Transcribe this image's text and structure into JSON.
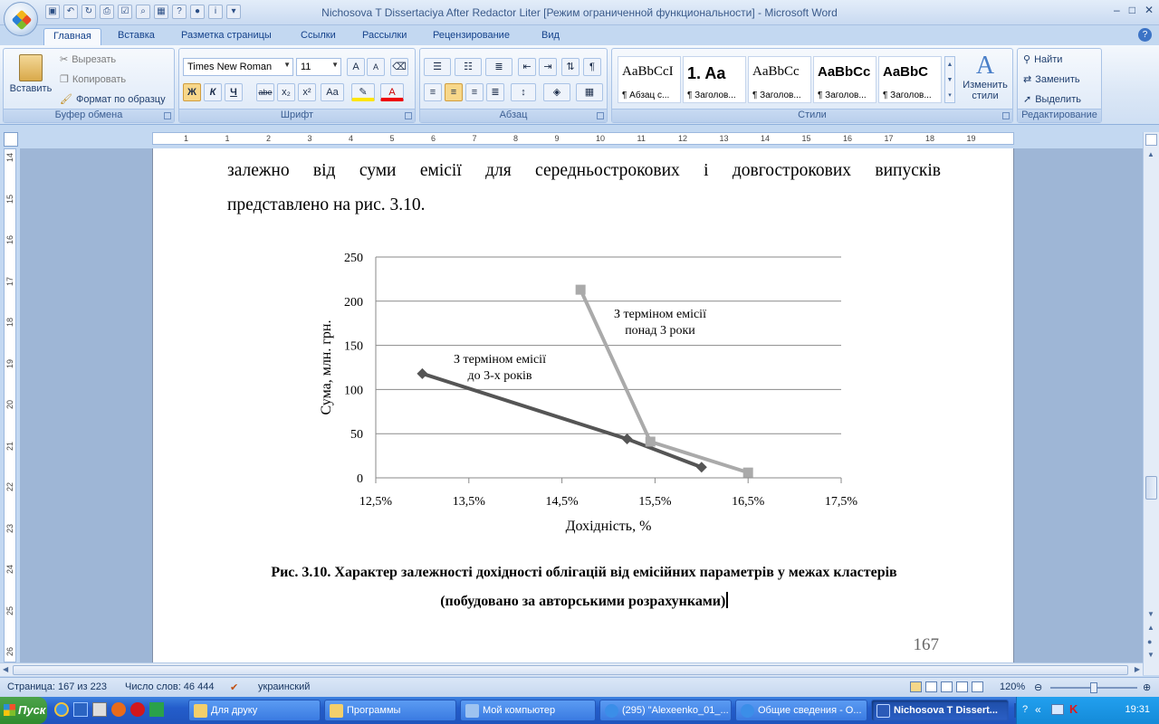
{
  "window": {
    "title": "Nichosova T Dissertaciya After Redactor Liter [Режим ограниченной функциональности] - Microsoft Word",
    "controls": [
      "–",
      "□",
      "✕"
    ]
  },
  "tabs": [
    "Главная",
    "Вставка",
    "Разметка страницы",
    "Ссылки",
    "Рассылки",
    "Рецензирование",
    "Вид"
  ],
  "ribbon": {
    "clipboard": {
      "label": "Буфер обмена",
      "paste": "Вставить",
      "cut": "Вырезать",
      "copy": "Копировать",
      "format_painter": "Формат по образцу"
    },
    "font": {
      "label": "Шрифт",
      "family": "Times New Roman",
      "size": "11",
      "bold": "Ж",
      "italic": "К",
      "underline": "Ч",
      "strike": "abe",
      "subscript": "x₂",
      "superscript": "x²",
      "case": "Aa",
      "grow": "A",
      "shrink": "A"
    },
    "paragraph": {
      "label": "Абзац"
    },
    "styles": {
      "label": "Стили",
      "items": [
        {
          "sample": "AaBbCcI",
          "name": "¶ Абзац с..."
        },
        {
          "sample": "1.  Aa",
          "name": "¶ Заголов..."
        },
        {
          "sample": "AaBbCc",
          "name": "¶ Заголов..."
        },
        {
          "sample": "AaBbCc",
          "name": "¶ Заголов..."
        },
        {
          "sample": "AaBbC",
          "name": "¶ Заголов..."
        }
      ],
      "change_styles": "Изменить стили"
    },
    "editing": {
      "label": "Редактирование",
      "find": "Найти",
      "replace": "Заменить",
      "select": "Выделить"
    }
  },
  "ruler": {
    "h_numbers": [
      "1",
      "1",
      "2",
      "3",
      "4",
      "5",
      "6",
      "7",
      "8",
      "9",
      "10",
      "11",
      "12",
      "13",
      "14",
      "15",
      "16",
      "17",
      "18",
      "19"
    ],
    "v_numbers": [
      "14",
      "15",
      "16",
      "17",
      "18",
      "19",
      "20",
      "21",
      "22",
      "23",
      "24",
      "25",
      "26"
    ]
  },
  "document": {
    "line1_words": [
      "залежно",
      "від",
      "суми",
      "емісії",
      "для",
      "середньострокових",
      "і",
      "довгострокових",
      "випусків"
    ],
    "line2": "представлено на рис. 3.10.",
    "caption_line1": "Рис. 3.10. Характер залежності дохідності облігацій від емісійних параметрів у межах кластерів",
    "caption_line2": "(побудовано за авторськими розрахунками)",
    "page_number": "167"
  },
  "chart_data": {
    "type": "line",
    "xlabel": "Дохідність, %",
    "ylabel": "Сума, млн. грн.",
    "xlim": [
      12.5,
      17.5
    ],
    "ylim": [
      0,
      250
    ],
    "x_ticks": [
      "12,5%",
      "13,5%",
      "14,5%",
      "15,5%",
      "16,5%",
      "17,5%"
    ],
    "y_ticks": [
      "0",
      "50",
      "100",
      "150",
      "200",
      "250"
    ],
    "grid": true,
    "series": [
      {
        "name": "З терміном емісії до 3-х років",
        "label_lines": [
          "З терміном емісії",
          "до 3-х років"
        ],
        "color": "#555555",
        "marker": "diamond",
        "x": [
          13.0,
          15.2,
          16.0
        ],
        "y": [
          118,
          44,
          12
        ]
      },
      {
        "name": "З терміном емісії понад 3 роки",
        "label_lines": [
          "З терміном емісії",
          "понад 3 роки"
        ],
        "color": "#aaaaaa",
        "marker": "square",
        "x": [
          14.7,
          15.45,
          16.5
        ],
        "y": [
          213,
          41,
          6
        ]
      }
    ]
  },
  "statusbar": {
    "page": "Страница: 167 из 223",
    "words": "Число слов: 46 444",
    "language": "украинский",
    "zoom": "120%"
  },
  "taskbar": {
    "start": "Пуск",
    "tasks": [
      {
        "label": "Для друку",
        "active": false
      },
      {
        "label": "Программы",
        "active": false
      },
      {
        "label": "Мой компьютер",
        "active": false
      },
      {
        "label": "(295) \"Alexeenko_01_...",
        "active": false
      },
      {
        "label": "Общие сведения - О...",
        "active": false
      },
      {
        "label": "Nichosova T Dissert...",
        "active": true
      }
    ],
    "lang": "UK",
    "clock": "19:31"
  }
}
